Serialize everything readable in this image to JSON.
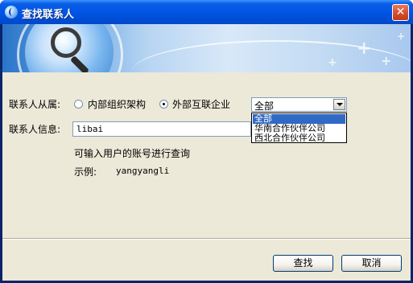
{
  "window": {
    "title": "查找联系人",
    "close_glyph": "✕"
  },
  "form": {
    "affiliation_label": "联系人从属:",
    "radio_internal": "内部组织架构",
    "radio_external": "外部互联企业",
    "selected_radio": "external",
    "combo_value": "全部",
    "dropdown_options": [
      "全部",
      "华南合作伙伴公司",
      "西北合作伙伴公司"
    ],
    "dropdown_selected_index": 0,
    "info_label": "联系人信息:",
    "info_value": "libai",
    "hint": "可输入用户的账号进行查询",
    "example_label": "示例:",
    "example_value": "yangyangli"
  },
  "buttons": {
    "search": "查找",
    "cancel": "取消"
  },
  "icons": [
    "app-icon",
    "close-icon",
    "magnifier-icon",
    "dropdown-arrow-icon"
  ],
  "colors": {
    "titlebar": "#0054e3",
    "dialog_bg": "#ece9d8",
    "selection": "#316ac5",
    "close": "#d34a26"
  }
}
